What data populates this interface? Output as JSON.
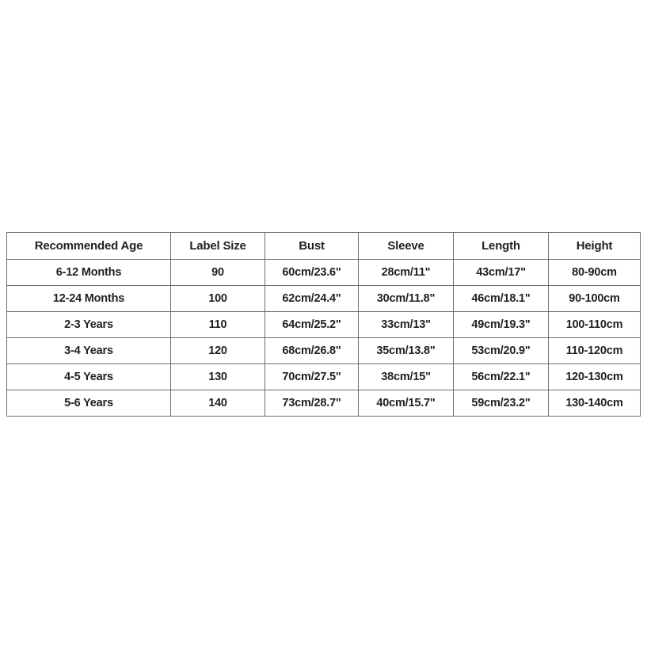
{
  "chart_data": {
    "type": "table",
    "title": "",
    "columns": [
      "Recommended Age",
      "Label Size",
      "Bust",
      "Sleeve",
      "Length",
      "Height"
    ],
    "rows": [
      [
        "6-12 Months",
        "90",
        "60cm/23.6\"",
        "28cm/11\"",
        "43cm/17\"",
        "80-90cm"
      ],
      [
        "12-24 Months",
        "100",
        "62cm/24.4\"",
        "30cm/11.8\"",
        "46cm/18.1\"",
        "90-100cm"
      ],
      [
        "2-3 Years",
        "110",
        "64cm/25.2\"",
        "33cm/13\"",
        "49cm/19.3\"",
        "100-110cm"
      ],
      [
        "3-4 Years",
        "120",
        "68cm/26.8\"",
        "35cm/13.8\"",
        "53cm/20.9\"",
        "110-120cm"
      ],
      [
        "4-5 Years",
        "130",
        "70cm/27.5\"",
        "38cm/15\"",
        "56cm/22.1\"",
        "120-130cm"
      ],
      [
        "5-6 Years",
        "140",
        "73cm/28.7\"",
        "40cm/15.7\"",
        "59cm/23.2\"",
        "130-140cm"
      ]
    ]
  },
  "style": {
    "background_color": "#ffffff",
    "border_color": "#6e6e6e",
    "text_color": "#231f20"
  }
}
